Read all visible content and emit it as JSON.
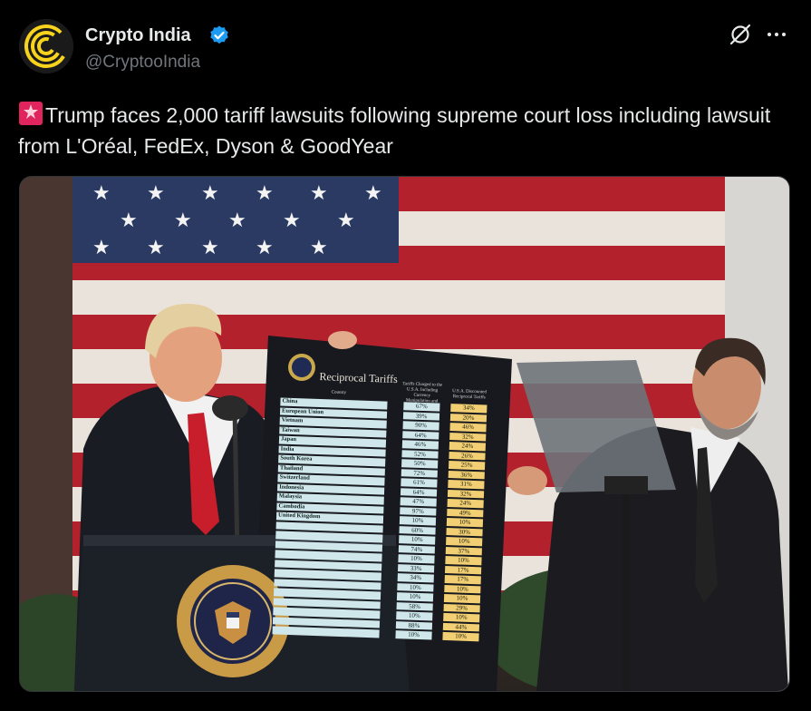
{
  "account": {
    "name": "Crypto India",
    "handle": "@CryptooIndia",
    "verified": true,
    "avatar_icon": "crypto-india-c-logo",
    "brand_color": "#f7d31e"
  },
  "actions": {
    "grok_icon": "grok-icon",
    "more_icon": "more-dots-icon"
  },
  "tweet": {
    "emoji": "police-siren-icon",
    "text": "Trump faces 2,000 tariff lawsuits following supreme court loss including lawsuit from L'Oréal, FedEx, Dyson & GoodYear"
  },
  "board": {
    "title": "Reciprocal Tariffs",
    "col_country": "Country",
    "col_charged": "Tariffs Charged to the U.S.A. Including Currency Manipulation and Trade Barriers",
    "col_recip": "U.S.A. Discounted Reciprocal Tariffs",
    "rows": [
      {
        "country": "China",
        "charged": "67%",
        "recip": "34%"
      },
      {
        "country": "European Union",
        "charged": "39%",
        "recip": "20%"
      },
      {
        "country": "Vietnam",
        "charged": "90%",
        "recip": "46%"
      },
      {
        "country": "Taiwan",
        "charged": "64%",
        "recip": "32%"
      },
      {
        "country": "Japan",
        "charged": "46%",
        "recip": "24%"
      },
      {
        "country": "India",
        "charged": "52%",
        "recip": "26%"
      },
      {
        "country": "South Korea",
        "charged": "50%",
        "recip": "25%"
      },
      {
        "country": "Thailand",
        "charged": "72%",
        "recip": "36%"
      },
      {
        "country": "Switzerland",
        "charged": "61%",
        "recip": "31%"
      },
      {
        "country": "Indonesia",
        "charged": "64%",
        "recip": "32%"
      },
      {
        "country": "Malaysia",
        "charged": "47%",
        "recip": "24%"
      },
      {
        "country": "Cambodia",
        "charged": "97%",
        "recip": "49%"
      },
      {
        "country": "United Kingdom",
        "charged": "10%",
        "recip": "10%"
      },
      {
        "country": "",
        "charged": "60%",
        "recip": "30%"
      },
      {
        "country": "",
        "charged": "10%",
        "recip": "10%"
      },
      {
        "country": "",
        "charged": "74%",
        "recip": "37%"
      },
      {
        "country": "",
        "charged": "10%",
        "recip": "10%"
      },
      {
        "country": "",
        "charged": "33%",
        "recip": "17%"
      },
      {
        "country": "",
        "charged": "34%",
        "recip": "17%"
      },
      {
        "country": "",
        "charged": "10%",
        "recip": "10%"
      },
      {
        "country": "",
        "charged": "10%",
        "recip": "10%"
      },
      {
        "country": "",
        "charged": "58%",
        "recip": "29%"
      },
      {
        "country": "",
        "charged": "10%",
        "recip": "10%"
      },
      {
        "country": "",
        "charged": "88%",
        "recip": "44%"
      },
      {
        "country": "",
        "charged": "10%",
        "recip": "10%"
      }
    ]
  }
}
